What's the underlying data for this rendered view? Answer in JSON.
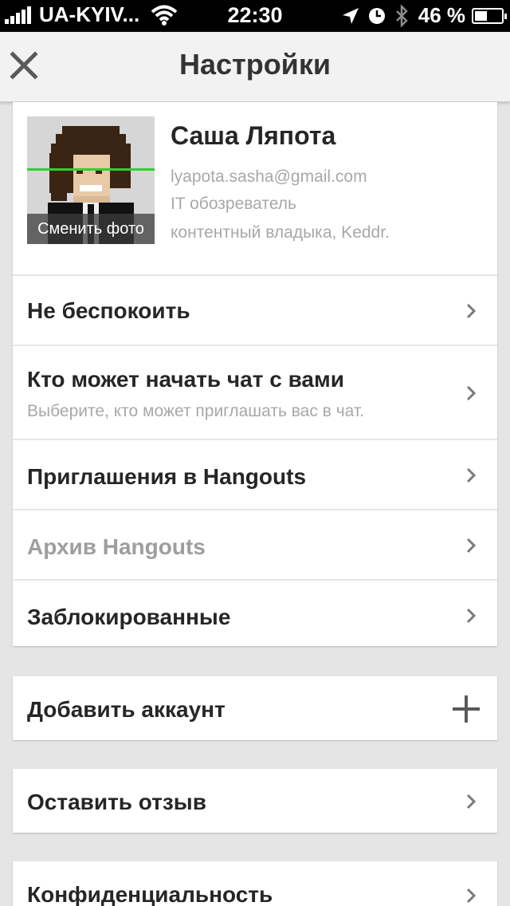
{
  "status_bar": {
    "carrier": "UA-KYIV...",
    "time": "22:30",
    "battery": "46 %",
    "battery_level": 0.46
  },
  "header": {
    "title": "Настройки"
  },
  "profile": {
    "name": "Саша Ляпота",
    "email": "lyapota.sasha@gmail.com",
    "line2": "IT обозреватель",
    "line3": "контентный владыка, Keddr.",
    "change_photo": "Сменить фото"
  },
  "settings": {
    "do_not_disturb": "Не беспокоить",
    "who_can_chat": "Кто может начать чат с вами",
    "who_can_chat_sub": "Выберите, кто может приглашать вас в чат.",
    "invites": "Приглашения в Hangouts",
    "archive": "Архив Hangouts",
    "blocked": "Заблокированные"
  },
  "add_account": "Добавить аккаунт",
  "feedback": "Оставить отзыв",
  "privacy": "Конфиденциальность",
  "colors": {
    "accent_line": "#2fd02f",
    "label": "#262626",
    "muted": "#a8a8a8"
  }
}
